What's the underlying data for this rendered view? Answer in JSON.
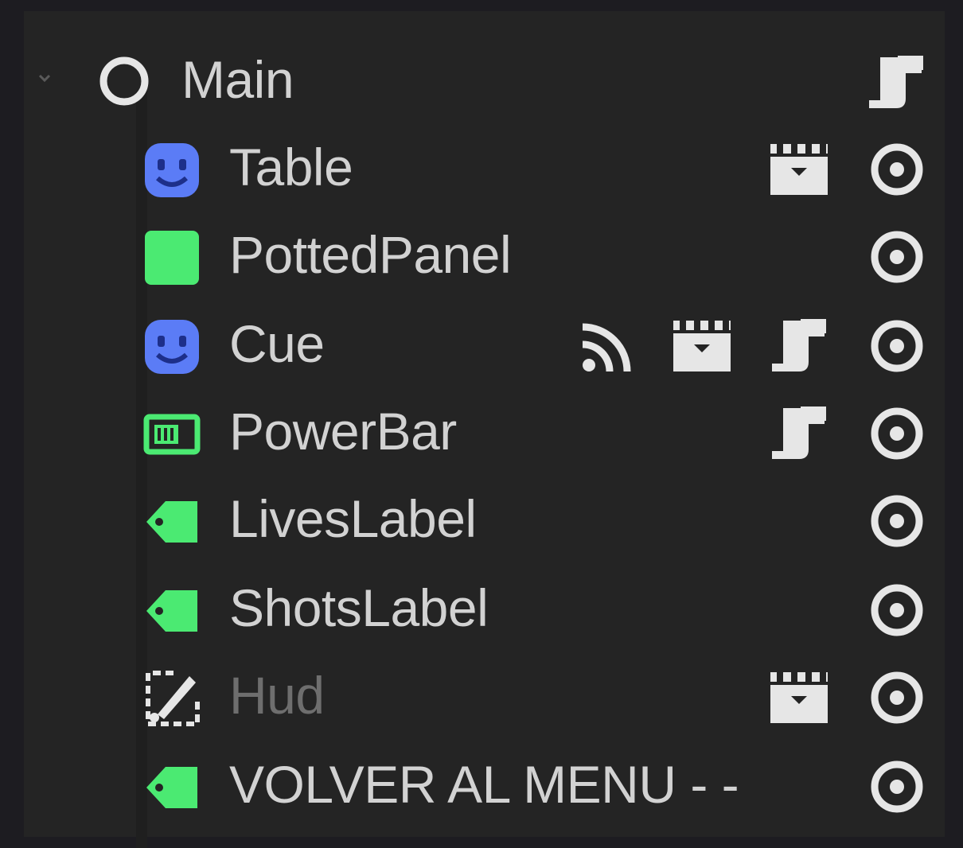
{
  "tree": {
    "root": {
      "label": "Main",
      "expanded": true,
      "type_icon": "node-2d-circle-icon",
      "badges": [
        "script-icon"
      ]
    },
    "children": [
      {
        "label": "Table",
        "type_icon": "character-body-icon",
        "type_color": "#5b7cf6",
        "badges": [
          "clapper-icon"
        ],
        "visible": true,
        "dimmed": false
      },
      {
        "label": "PottedPanel",
        "type_icon": "panel-icon",
        "type_color": "#4bea72",
        "badges": [],
        "visible": true,
        "dimmed": false
      },
      {
        "label": "Cue",
        "type_icon": "character-body-icon",
        "type_color": "#5b7cf6",
        "badges": [
          "signal-icon",
          "clapper-icon",
          "script-icon"
        ],
        "visible": true,
        "dimmed": false
      },
      {
        "label": "PowerBar",
        "type_icon": "progress-bar-icon",
        "type_color": "#4bea72",
        "badges": [
          "script-icon"
        ],
        "visible": true,
        "dimmed": false
      },
      {
        "label": "LivesLabel",
        "type_icon": "label-tag-icon",
        "type_color": "#4bea72",
        "badges": [],
        "visible": true,
        "dimmed": false
      },
      {
        "label": "ShotsLabel",
        "type_icon": "label-tag-icon",
        "type_color": "#4bea72",
        "badges": [],
        "visible": true,
        "dimmed": false
      },
      {
        "label": "Hud",
        "type_icon": "canvas-edit-icon",
        "type_color": "#e8e8e8",
        "badges": [
          "clapper-icon"
        ],
        "visible": true,
        "dimmed": true
      },
      {
        "label": "VOLVER AL MENU - -",
        "type_icon": "label-tag-icon",
        "type_color": "#4bea72",
        "badges": [],
        "visible": true,
        "dimmed": false
      }
    ]
  },
  "colors": {
    "panel_bg": "#242424",
    "text": "#d2d2d2",
    "dim_text": "#6e6e6e",
    "icon_light": "#e6e6e6",
    "node2d_blue": "#5b7cf6",
    "control_green": "#4bea72"
  }
}
